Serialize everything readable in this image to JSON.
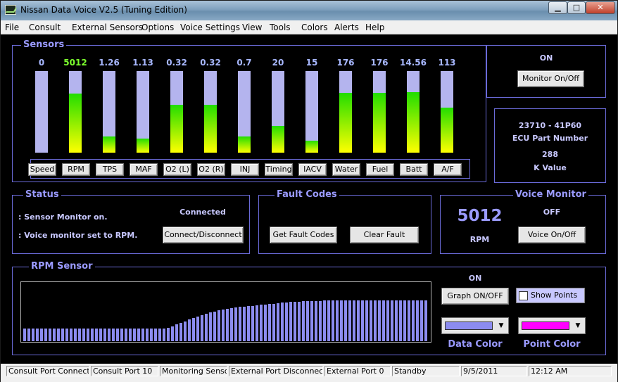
{
  "window": {
    "title": "Nissan Data Voice V2.5 (Tuning Edition)"
  },
  "menu": [
    "File",
    "Consult",
    "External Sensors",
    "Options",
    "Voice Settings",
    "View",
    "Tools",
    "Colors",
    "Alerts",
    "Help"
  ],
  "sensors": {
    "title": "Sensors",
    "items": [
      {
        "label": "Speed",
        "value": "0",
        "level": 0,
        "highlight": false
      },
      {
        "label": "RPM",
        "value": "5012",
        "level": 0.72,
        "highlight": true
      },
      {
        "label": "TPS",
        "value": "1.26",
        "level": 0.2,
        "highlight": false
      },
      {
        "label": "MAF",
        "value": "1.13",
        "level": 0.17,
        "highlight": false
      },
      {
        "label": "O2 (L)",
        "value": "0.32",
        "level": 0.59,
        "highlight": false
      },
      {
        "label": "O2 (R)",
        "value": "0.32",
        "level": 0.59,
        "highlight": false
      },
      {
        "label": "INJ",
        "value": "0.7",
        "level": 0.2,
        "highlight": false
      },
      {
        "label": "Timing",
        "value": "20",
        "level": 0.33,
        "highlight": false
      },
      {
        "label": "IACV",
        "value": "15",
        "level": 0.15,
        "highlight": false
      },
      {
        "label": "Water",
        "value": "176",
        "level": 0.73,
        "highlight": false
      },
      {
        "label": "Fuel",
        "value": "176",
        "level": 0.73,
        "highlight": false
      },
      {
        "label": "Batt",
        "value": "14.56",
        "level": 0.74,
        "highlight": false
      },
      {
        "label": "A/F",
        "value": "113",
        "level": 0.55,
        "highlight": false
      }
    ]
  },
  "monitor": {
    "state": "ON",
    "button": "Monitor On/Off"
  },
  "ecu": {
    "part": "23710 - 41P60",
    "part_label": "ECU Part Number",
    "k_value": "288",
    "k_label": "K Value"
  },
  "status": {
    "title": "Status",
    "line1": ": Sensor Monitor on.",
    "line2": ": Voice monitor set to RPM.",
    "connection": "Connected",
    "button": "Connect/Disconnect"
  },
  "fault_codes": {
    "title": "Fault Codes",
    "get_button": "Get Fault Codes",
    "clear_button": "Clear Fault Codes"
  },
  "voice_monitor": {
    "title": "Voice Monitor",
    "value": "5012",
    "unit": "RPM",
    "state": "OFF",
    "button": "Voice On/Off"
  },
  "graph": {
    "title": "RPM Sensor",
    "state": "ON",
    "button": "Graph ON/OFF",
    "show_points_label": "Show Points",
    "show_points_checked": false,
    "data_color_label": "Data Color",
    "point_color_label": "Point Color",
    "data_color": "#8c8cf0",
    "point_color": "#ff00ff",
    "levels": [
      0.31,
      0.31,
      0.31,
      0.31,
      0.31,
      0.31,
      0.31,
      0.31,
      0.31,
      0.31,
      0.31,
      0.31,
      0.31,
      0.31,
      0.31,
      0.31,
      0.31,
      0.31,
      0.31,
      0.31,
      0.31,
      0.31,
      0.31,
      0.31,
      0.31,
      0.31,
      0.31,
      0.31,
      0.31,
      0.31,
      0.31,
      0.31,
      0.31,
      0.31,
      0.33,
      0.37,
      0.41,
      0.45,
      0.49,
      0.53,
      0.57,
      0.61,
      0.64,
      0.67,
      0.7,
      0.73,
      0.75,
      0.77,
      0.79,
      0.81,
      0.82,
      0.84,
      0.85,
      0.86,
      0.87,
      0.88,
      0.89,
      0.9,
      0.91,
      0.92,
      0.93,
      0.94,
      0.95,
      0.96,
      0.97,
      0.97,
      0.98,
      0.98,
      0.99,
      0.99,
      0.99,
      1.0,
      1.0,
      1.0,
      1.0,
      1.0,
      1.0,
      1.0,
      1.0,
      1.0,
      1.0,
      1.0,
      1.0,
      1.0,
      1.0,
      1.0,
      1.0,
      1.0,
      1.0,
      1.0,
      1.0,
      1.0,
      1.0,
      1.0,
      1.0,
      1.0
    ]
  },
  "statusbar": [
    "Consult Port Connected",
    "Consult Port 10",
    "Monitoring Sensors",
    "External Port Disconnected",
    "External Port 0",
    "Standby",
    "9/5/2011",
    "12:12 AM"
  ]
}
